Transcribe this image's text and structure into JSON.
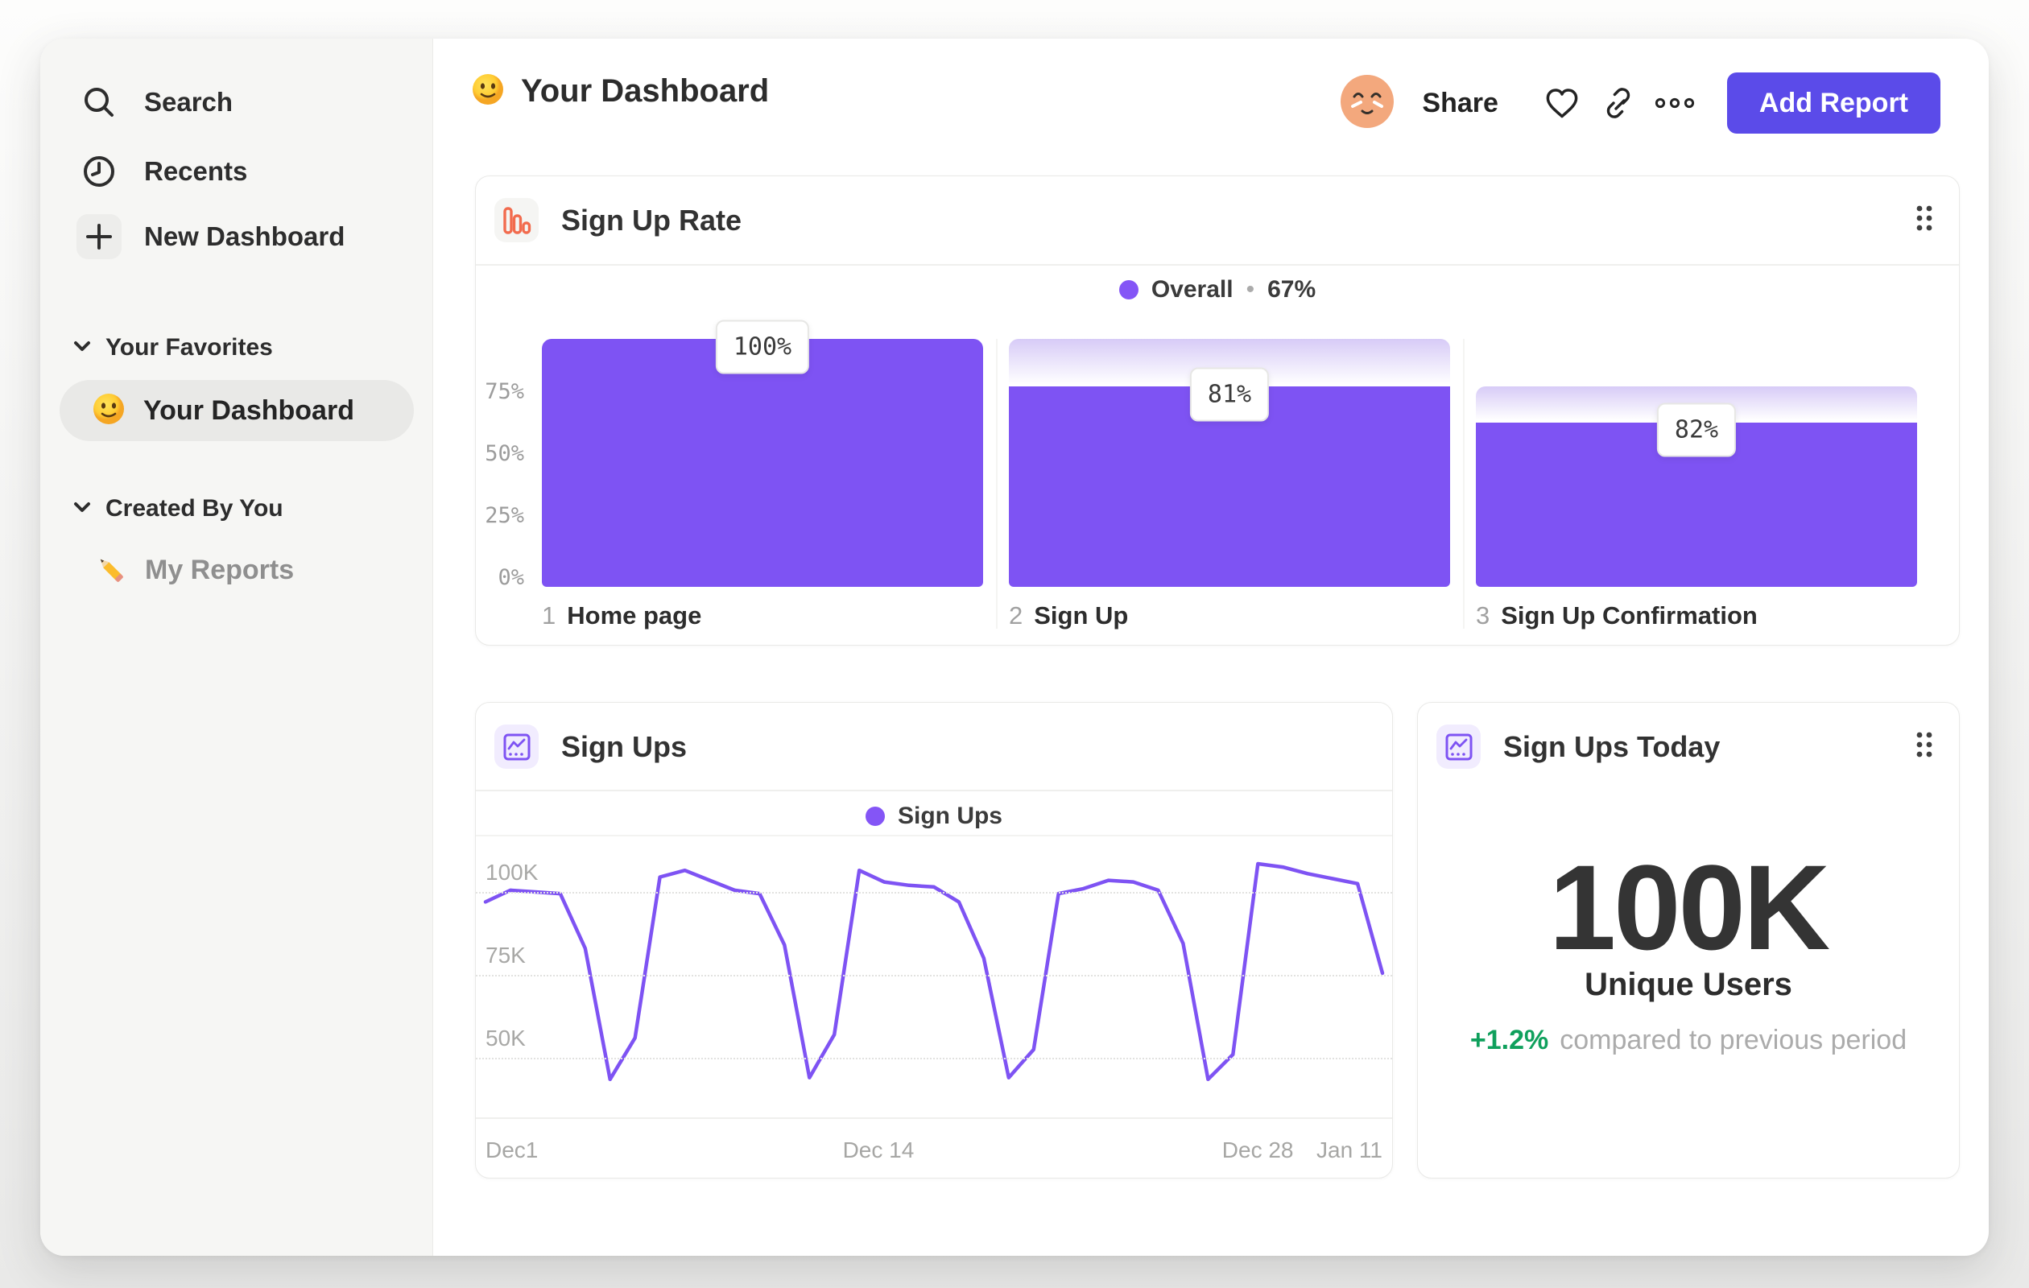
{
  "sidebar": {
    "items": [
      {
        "label": "Search",
        "icon": "search-icon"
      },
      {
        "label": "Recents",
        "icon": "clock-icon"
      },
      {
        "label": "New Dashboard",
        "icon": "plus-icon"
      }
    ],
    "sections": [
      {
        "label": "Your Favorites",
        "items": [
          {
            "label": "Your Dashboard",
            "icon": "smiley-emoji",
            "selected": true
          }
        ]
      },
      {
        "label": "Created By You",
        "items": [
          {
            "label": "My Reports",
            "icon": "pencil-emoji",
            "selected": false
          }
        ]
      }
    ]
  },
  "header": {
    "title": "Your Dashboard",
    "share_label": "Share",
    "add_report_label": "Add Report"
  },
  "cards": {
    "funnel": {
      "title": "Sign Up Rate",
      "legend_label": "Overall",
      "legend_sep": "•",
      "legend_value": "67%"
    },
    "line": {
      "title": "Sign Ups",
      "legend_label": "Sign Ups"
    },
    "metric": {
      "title": "Sign Ups Today",
      "value": "100K",
      "label": "Unique Users",
      "delta": "+1.2%",
      "delta_caption": "compared to previous period"
    }
  },
  "chart_data": [
    {
      "type": "bar",
      "subtype": "funnel",
      "title": "Sign Up Rate",
      "overall_conversion": "67%",
      "steps": [
        {
          "step": "1",
          "label": "Home page",
          "conversion_from_previous_pct": 100,
          "overall_pct": 100
        },
        {
          "step": "2",
          "label": "Sign Up",
          "conversion_from_previous_pct": 81,
          "overall_pct": 81
        },
        {
          "step": "3",
          "label": "Sign Up Confirmation",
          "conversion_from_previous_pct": 82,
          "overall_pct": 66.4
        }
      ],
      "y_ticks": [
        "75%",
        "50%",
        "25%",
        "0%"
      ],
      "y_tick_values": [
        75,
        50,
        25,
        0
      ],
      "ylim": [
        0,
        100
      ],
      "grid": false,
      "legend_position": "top-center"
    },
    {
      "type": "line",
      "title": "Sign Ups",
      "series": [
        {
          "name": "Sign Ups",
          "unit": "K",
          "values": [
            97,
            100.5,
            100,
            99.5,
            83,
            43.5,
            56,
            104.5,
            106.5,
            103.5,
            100.5,
            99.5,
            84,
            44,
            57,
            106.5,
            103,
            102,
            101.5,
            97,
            80,
            44,
            52.5,
            99.5,
            101,
            103.5,
            103,
            100.5,
            84.5,
            43.5,
            51,
            108.5,
            107.5,
            105.5,
            104,
            102.5,
            75.5
          ]
        }
      ],
      "x_range": "Dec 1 - Jan 11",
      "x_ticks": [
        "Dec1",
        "Dec 14",
        "Dec 28",
        "Jan 11"
      ],
      "x_tick_positions": [
        0,
        0.438,
        0.861,
        1
      ],
      "y_ticks": [
        "100K",
        "75K",
        "50K"
      ],
      "y_tick_values": [
        100,
        75,
        50
      ],
      "ylim": [
        40,
        112
      ],
      "grid": "dotted-horizontal",
      "legend_position": "top-center"
    },
    {
      "type": "metric",
      "title": "Sign Ups Today",
      "value": "100K",
      "label": "Unique Users",
      "delta_pct": "+1.2%",
      "delta_caption": "compared to previous period"
    }
  ],
  "colors": {
    "purple": "#7E53F3",
    "purple_dot": "#8455F6",
    "ghost_top": "#D7CBF7",
    "button": "#5B4BE9",
    "orange": "#F26B4E",
    "green": "#0FA05C",
    "sidebar_bg": "#F6F6F4",
    "avatar_skin": "#F3A87D"
  }
}
